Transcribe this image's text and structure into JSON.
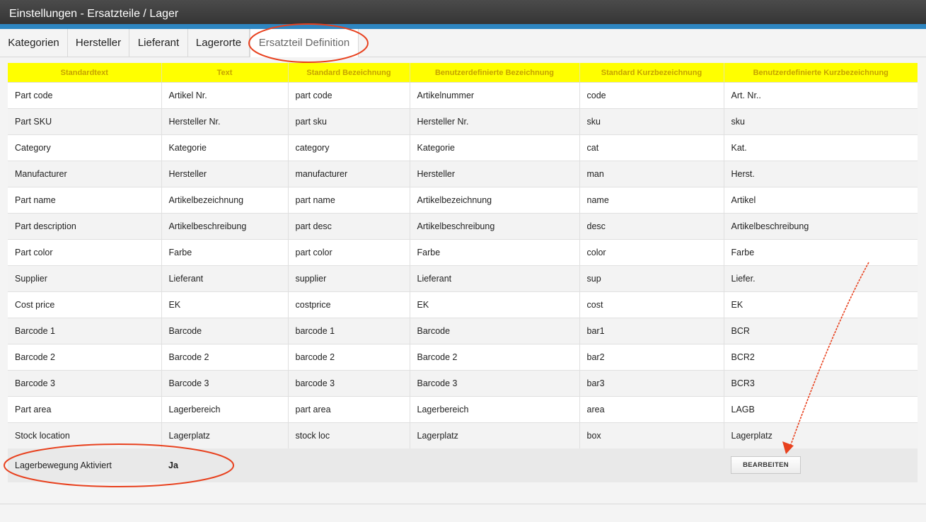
{
  "window": {
    "title": "Einstellungen - Ersatzteile / Lager"
  },
  "tabs": [
    {
      "label": "Kategorien"
    },
    {
      "label": "Hersteller"
    },
    {
      "label": "Lieferant"
    },
    {
      "label": "Lagerorte"
    },
    {
      "label": "Ersatzteil Definition",
      "active": true
    }
  ],
  "table": {
    "columns": [
      "Standardtext",
      "Text",
      "Standard Bezeichnung",
      "Benutzerdefinierte Bezeichnung",
      "Standard Kurzbezeichnung",
      "Benutzerdefinierte Kurzbezeichnung"
    ],
    "rows": [
      [
        "Part code",
        "Artikel Nr.",
        "part code",
        "Artikelnummer",
        "code",
        "Art. Nr.."
      ],
      [
        "Part SKU",
        "Hersteller Nr.",
        "part sku",
        "Hersteller Nr.",
        "sku",
        "sku"
      ],
      [
        "Category",
        "Kategorie",
        "category",
        "Kategorie",
        "cat",
        "Kat."
      ],
      [
        "Manufacturer",
        "Hersteller",
        "manufacturer",
        "Hersteller",
        "man",
        "Herst."
      ],
      [
        "Part name",
        "Artikelbezeichnung",
        "part name",
        "Artikelbezeichnung",
        "name",
        "Artikel"
      ],
      [
        "Part description",
        "Artikelbeschreibung",
        "part desc",
        "Artikelbeschreibung",
        "desc",
        "Artikelbeschreibung"
      ],
      [
        "Part color",
        "Farbe",
        "part color",
        "Farbe",
        "color",
        "Farbe"
      ],
      [
        "Supplier",
        "Lieferant",
        "supplier",
        "Lieferant",
        "sup",
        "Liefer."
      ],
      [
        "Cost price",
        "EK",
        "costprice",
        "EK",
        "cost",
        "EK"
      ],
      [
        "Barcode 1",
        "Barcode",
        "barcode 1",
        "Barcode",
        "bar1",
        "BCR"
      ],
      [
        "Barcode 2",
        "Barcode 2",
        "barcode 2",
        "Barcode 2",
        "bar2",
        "BCR2"
      ],
      [
        "Barcode 3",
        "Barcode 3",
        "barcode 3",
        "Barcode 3",
        "bar3",
        "BCR3"
      ],
      [
        "Part area",
        "Lagerbereich",
        "part area",
        "Lagerbereich",
        "area",
        "LAGB"
      ],
      [
        "Stock location",
        "Lagerplatz",
        "stock loc",
        "Lagerplatz",
        "box",
        "Lagerplatz"
      ]
    ]
  },
  "footer": {
    "label": "Lagerbewegung Aktiviert",
    "value": "Ja",
    "edit_button": "BEARBEITEN"
  },
  "colors": {
    "header_bg": "#ffff00",
    "header_text": "#c6a200",
    "accent": "#2e86c1",
    "annotation": "#e8411e"
  }
}
